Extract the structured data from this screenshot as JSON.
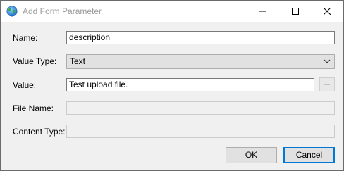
{
  "window": {
    "title": "Add Form Parameter",
    "icon": "globe-icon"
  },
  "titlebar_buttons": {
    "minimize_icon": "minimize-icon",
    "maximize_icon": "maximize-icon",
    "close_icon": "close-icon"
  },
  "form": {
    "name_label": "Name:",
    "name_value": "description",
    "value_type_label": "Value Type:",
    "value_type_selected": "Text",
    "value_label": "Value:",
    "value_value": "Test upload file.",
    "browse_label": "...",
    "file_name_label": "File Name:",
    "file_name_value": "",
    "content_type_label": "Content Type:",
    "content_type_value": ""
  },
  "buttons": {
    "ok_label": "OK",
    "cancel_label": "Cancel"
  },
  "colors": {
    "dialog_background": "#f0f0f0",
    "default_button_border": "#0078d7"
  }
}
